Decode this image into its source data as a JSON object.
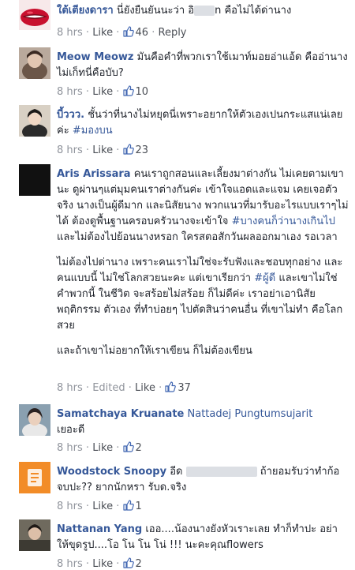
{
  "comments": [
    {
      "author": "ใต้เตียงดารา",
      "text_before": "นี่ยังยืนยันนะว่า อิ",
      "text_after": "n คือไม่ได้ด่านาง",
      "time": "8 hrs",
      "like": "Like",
      "count": "46",
      "reply": "Reply"
    },
    {
      "author": "Meow Meowz",
      "text": "มันคือคำที่พวกเราใช้เมาท์มอยอ่าแอ้ด คืออ่านางไม่เก็ทนี่คือบับ?",
      "time": "8 hrs",
      "like": "Like",
      "count": "10"
    },
    {
      "author": "บี้ววว.",
      "text": "ชั้นว่าที่นางไม่หยุดนี่เพราะอยากให้ตัวเองเปนกระแสแน่เลยค่ะ",
      "tag": "#มองบน",
      "time": "8 hrs",
      "like": "Like",
      "count": "23"
    },
    {
      "author": "Aris Arissara",
      "p1_a": "คนเราถูกสอนและเลี้ยงมาต่างกัน ไม่เคยตามเขานะ ดูผ่านๆแต่มุมคนเราต่างกันค่ะ เข้าใจแอดและแจม เคยเจอตัวจริง นางเป็นผู้ดีมาก และนิสัยนาง พวกแนวที่มารับอะไรแบบเราๆไม่ได้ ต้องดูพื้นฐานครอบครัวนางจะเข้าใจ",
      "p1_tag": "#บางคนก็ว่านางเกินไป",
      "p1_b": "และไม่ต้องไปย้อนนางหรอก ใครสตอสักวันผลออกมาเอง รอเวลา",
      "p2_a": "ไม่ต้องไปด่านาง เพราะคนเราไม่ใช่จะรับฟังและชอบทุกอย่าง และคนแบบนี้ ไม่ใช่โลกสวยนะคะ แต่เขาเรียกว่า",
      "p2_tag": "#ผู้ดี",
      "p2_b": "และเขาไม่ใช่คำพวกนี้ ในชีวิต จะสร้อยไม่สร้อย ก็ไม่ดีค่ะ เราอย่าเอานิสัย พฤติกรรม ตัวเอง ที่ทำบ่อยๆ ไปตัดสินว่าคนอื่น ที่เขาไม่ทำ คือโลกสวย",
      "p3": "และถ้าเขาไม่อยากให้เราเขียน ก็ไม่ต้องเขียน",
      "time": "8 hrs",
      "edited": "Edited",
      "like": "Like",
      "count": "37"
    },
    {
      "author": "Samatchaya Kruanate",
      "mention": "Nattadej Pungtumsujarit",
      "text": "เยอะดี",
      "time": "8 hrs",
      "like": "Like",
      "count": "2"
    },
    {
      "author": "Woodstock Snoopy",
      "text_before": "อีด",
      "text_after": "ถ้ายอมรับว่าทำก้อจบปะ?? ยากนักหรา รับด.จริง",
      "time": "8 hrs",
      "like": "Like",
      "count": "1"
    },
    {
      "author": "Nattanan Yang",
      "text": "เออ....น้องนางยังหัวเราะเลย ทำก็ทำปะ อย่าให้ขุดรูป....โอ โน โน โน่ !!! นะคะคุณflowers",
      "time": "8 hrs",
      "like": "Like",
      "count": "2"
    }
  ],
  "separator": "·"
}
